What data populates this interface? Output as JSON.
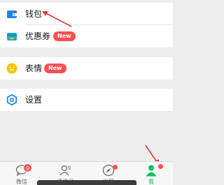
{
  "menu": {
    "wallet_label": "钱包",
    "coupons_label": "优惠券",
    "coupons_badge": "New",
    "emoji_label": "表情",
    "emoji_badge": "New",
    "settings_label": "设置"
  },
  "tabbar": {
    "chats_label": "微信",
    "chats_count": "9",
    "contacts_label": "通讯录",
    "discover_label": "发现",
    "me_label": "我"
  },
  "colors": {
    "accent": "#07c160",
    "badge": "#fa5151",
    "wallet_icon": "#1e88e5",
    "coupons_icon": "#16a8c8",
    "emoji_icon": "#f7c600",
    "settings_icon": "#1e88e5",
    "annotation_arrow": "#e53935"
  },
  "icons": {
    "wallet": "wallet-icon",
    "coupons": "card-icon",
    "emoji": "smiley-icon",
    "settings": "gear-icon",
    "chats": "chat-bubble-icon",
    "contacts": "contacts-icon",
    "discover": "compass-icon",
    "me": "person-icon"
  }
}
